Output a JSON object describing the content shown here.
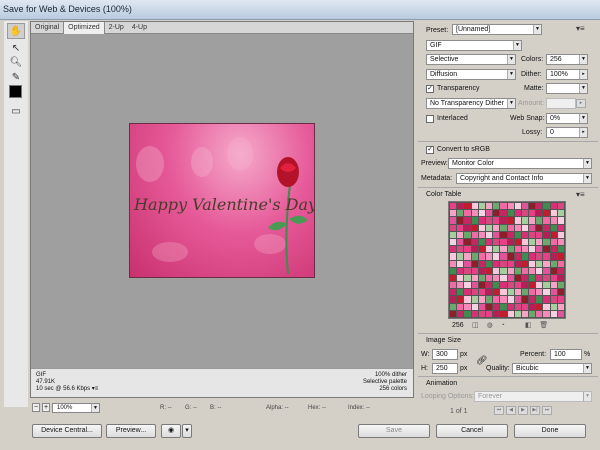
{
  "window": {
    "title": "Save for Web & Devices (100%)"
  },
  "tabs": [
    "Original",
    "Optimized",
    "2-Up",
    "4-Up"
  ],
  "active_tab": "Optimized",
  "preview": {
    "headline": "Happy Valentine's Day"
  },
  "canvas_info": {
    "format": "GIF",
    "size": "47.91K",
    "speed": "10 sec @ 56.6 Kbps",
    "dither": "100% dither",
    "palette": "Selective palette",
    "colors": "256 colors"
  },
  "status": {
    "zoom": "100%",
    "minus": "−",
    "plus": "+",
    "r": "R: --",
    "g": "G: --",
    "b": "B: --",
    "alpha": "Alpha: --",
    "hex": "Hex: --",
    "index": "Index: --"
  },
  "buttons": {
    "device_central": "Device Central...",
    "preview": "Preview...",
    "save": "Save",
    "cancel": "Cancel",
    "done": "Done"
  },
  "settings": {
    "preset_label": "Preset:",
    "preset_value": "[Unnamed]",
    "format": "GIF",
    "reduction": "Selective",
    "colors_label": "Colors:",
    "colors_value": "256",
    "dither_method": "Diffusion",
    "dither_label": "Dither:",
    "dither_value": "100%",
    "transparency_label": "Transparency",
    "transparency_checked": true,
    "matte_label": "Matte:",
    "transparency_dither": "No Transparency Dither",
    "amount_label": "Amount:",
    "interlaced_label": "Interlaced",
    "interlaced_checked": false,
    "websnap_label": "Web Snap:",
    "websnap_value": "0%",
    "lossy_label": "Lossy:",
    "lossy_value": "0",
    "convert_srgb_label": "Convert to sRGB",
    "convert_srgb_checked": true,
    "preview_label": "Preview:",
    "preview_value": "Monitor Color",
    "metadata_label": "Metadata:",
    "metadata_value": "Copyright and Contact Info"
  },
  "color_table": {
    "title": "Color Table",
    "count": "256",
    "palette": [
      "#e83f87",
      "#f26aa3",
      "#d92f77",
      "#f7a3c6",
      "#c42862",
      "#fbc7dc",
      "#e0559a",
      "#b51f55",
      "#f48bb8",
      "#d6487f",
      "#6aa86e",
      "#3f8b50",
      "#a6cfa1",
      "#8c1f2a",
      "#c21d2e",
      "#f5d2e1"
    ]
  },
  "image_size": {
    "title": "Image Size",
    "w_label": "W:",
    "w_value": "300",
    "h_label": "H:",
    "h_value": "250",
    "unit": "px",
    "percent_label": "Percent:",
    "percent_value": "100",
    "percent_unit": "%",
    "quality_label": "Quality:",
    "quality_value": "Bicubic"
  },
  "animation": {
    "title": "Animation",
    "looping_label": "Looping Options:",
    "looping_value": "Forever",
    "frame_counter": "1 of 1"
  }
}
